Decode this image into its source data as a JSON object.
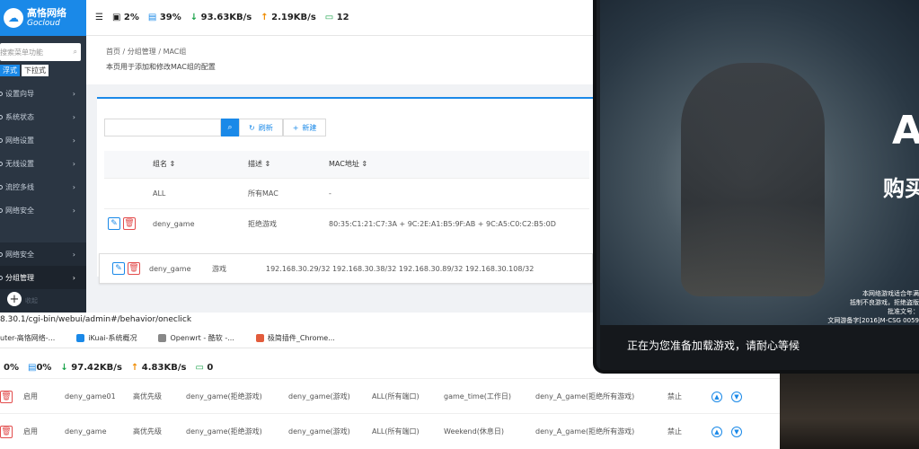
{
  "admin": {
    "brand_cn": "高恪网络",
    "brand_en": "Gocloud",
    "search_placeholder": "搜索菜单功能",
    "mode_tabs": [
      "浮式",
      "下拉式"
    ],
    "sidebar_items": [
      "设置向导",
      "系统状态",
      "网络设置",
      "无线设置",
      "流控多线",
      "网络安全",
      "分组管理"
    ],
    "stats": {
      "cpu": "2%",
      "mem": "39%",
      "down": "93.63KB/s",
      "up": "2.19KB/s",
      "devices": "12"
    },
    "breadcrumb": [
      "首页",
      "分组管理",
      "MAC组"
    ],
    "page_desc": "本页用于添加和修改MAC组的配置",
    "toolbar": {
      "refresh": "刷新",
      "add": "新建"
    },
    "table": {
      "headers": [
        "组名",
        "描述",
        "MAC地址"
      ],
      "rows": [
        {
          "name": "ALL",
          "desc": "所有MAC",
          "mac": "-"
        },
        {
          "name": "deny_game",
          "desc": "拒绝游戏",
          "mac": "80:35:C1:21:C7:3A + 9C:2E:A1:B5:9F:AB + 9C:A5:C0:C2:B5:0D"
        }
      ]
    },
    "overlay_row": {
      "name": "deny_game",
      "desc": "游戏",
      "ips": "192.168.30.29/32  192.168.30.38/32  192.168.30.89/32  192.168.30.108/32"
    },
    "overlay_sidebar": [
      "网络安全",
      "分组管理"
    ],
    "plus_label": "收起"
  },
  "browser": {
    "url": "8.30.1/cgi-bin/webui/admin#/behavior/oneclick",
    "bookmarks": [
      "uter-高恪网络-...",
      "iKuai-系统概况",
      "Openwrt - 酷软 -...",
      "极简插件_Chrome..."
    ]
  },
  "bottom": {
    "stats": {
      "cpu": "0%",
      "mem": "0%",
      "down": "97.42KB/s",
      "up": "4.83KB/s",
      "devices": "0"
    },
    "rows": [
      {
        "status": "启用",
        "name": "deny_game01",
        "priority": "高优先级",
        "group": "deny_game(拒绝游戏)",
        "ipgroup": "deny_game(游戏)",
        "port": "ALL(所有端口)",
        "time": "game_time(工作日)",
        "app": "deny_A_game(拒绝所有游戏)",
        "action": "禁止"
      },
      {
        "status": "启用",
        "name": "deny_game",
        "priority": "高优先级",
        "group": "deny_game(拒绝游戏)",
        "ipgroup": "deny_game(游戏)",
        "port": "ALL(所有端口)",
        "time": "Weekend(休息日)",
        "app": "deny_A_game(拒绝所有游戏)",
        "action": "禁止"
      }
    ]
  },
  "game": {
    "brand": "A",
    "brand_sub": "购买",
    "notice": [
      "本网络游戏适合年满",
      "抵制不良游戏，拒绝盗版",
      "批准文号：",
      "文网游备字[2016]M-CSG 0059"
    ],
    "loading": "正在为您准备加载游戏，请耐心等候"
  },
  "colors": {
    "accent": "#1a89e8",
    "sidebar": "#2b3643",
    "danger": "#e24c4c"
  }
}
